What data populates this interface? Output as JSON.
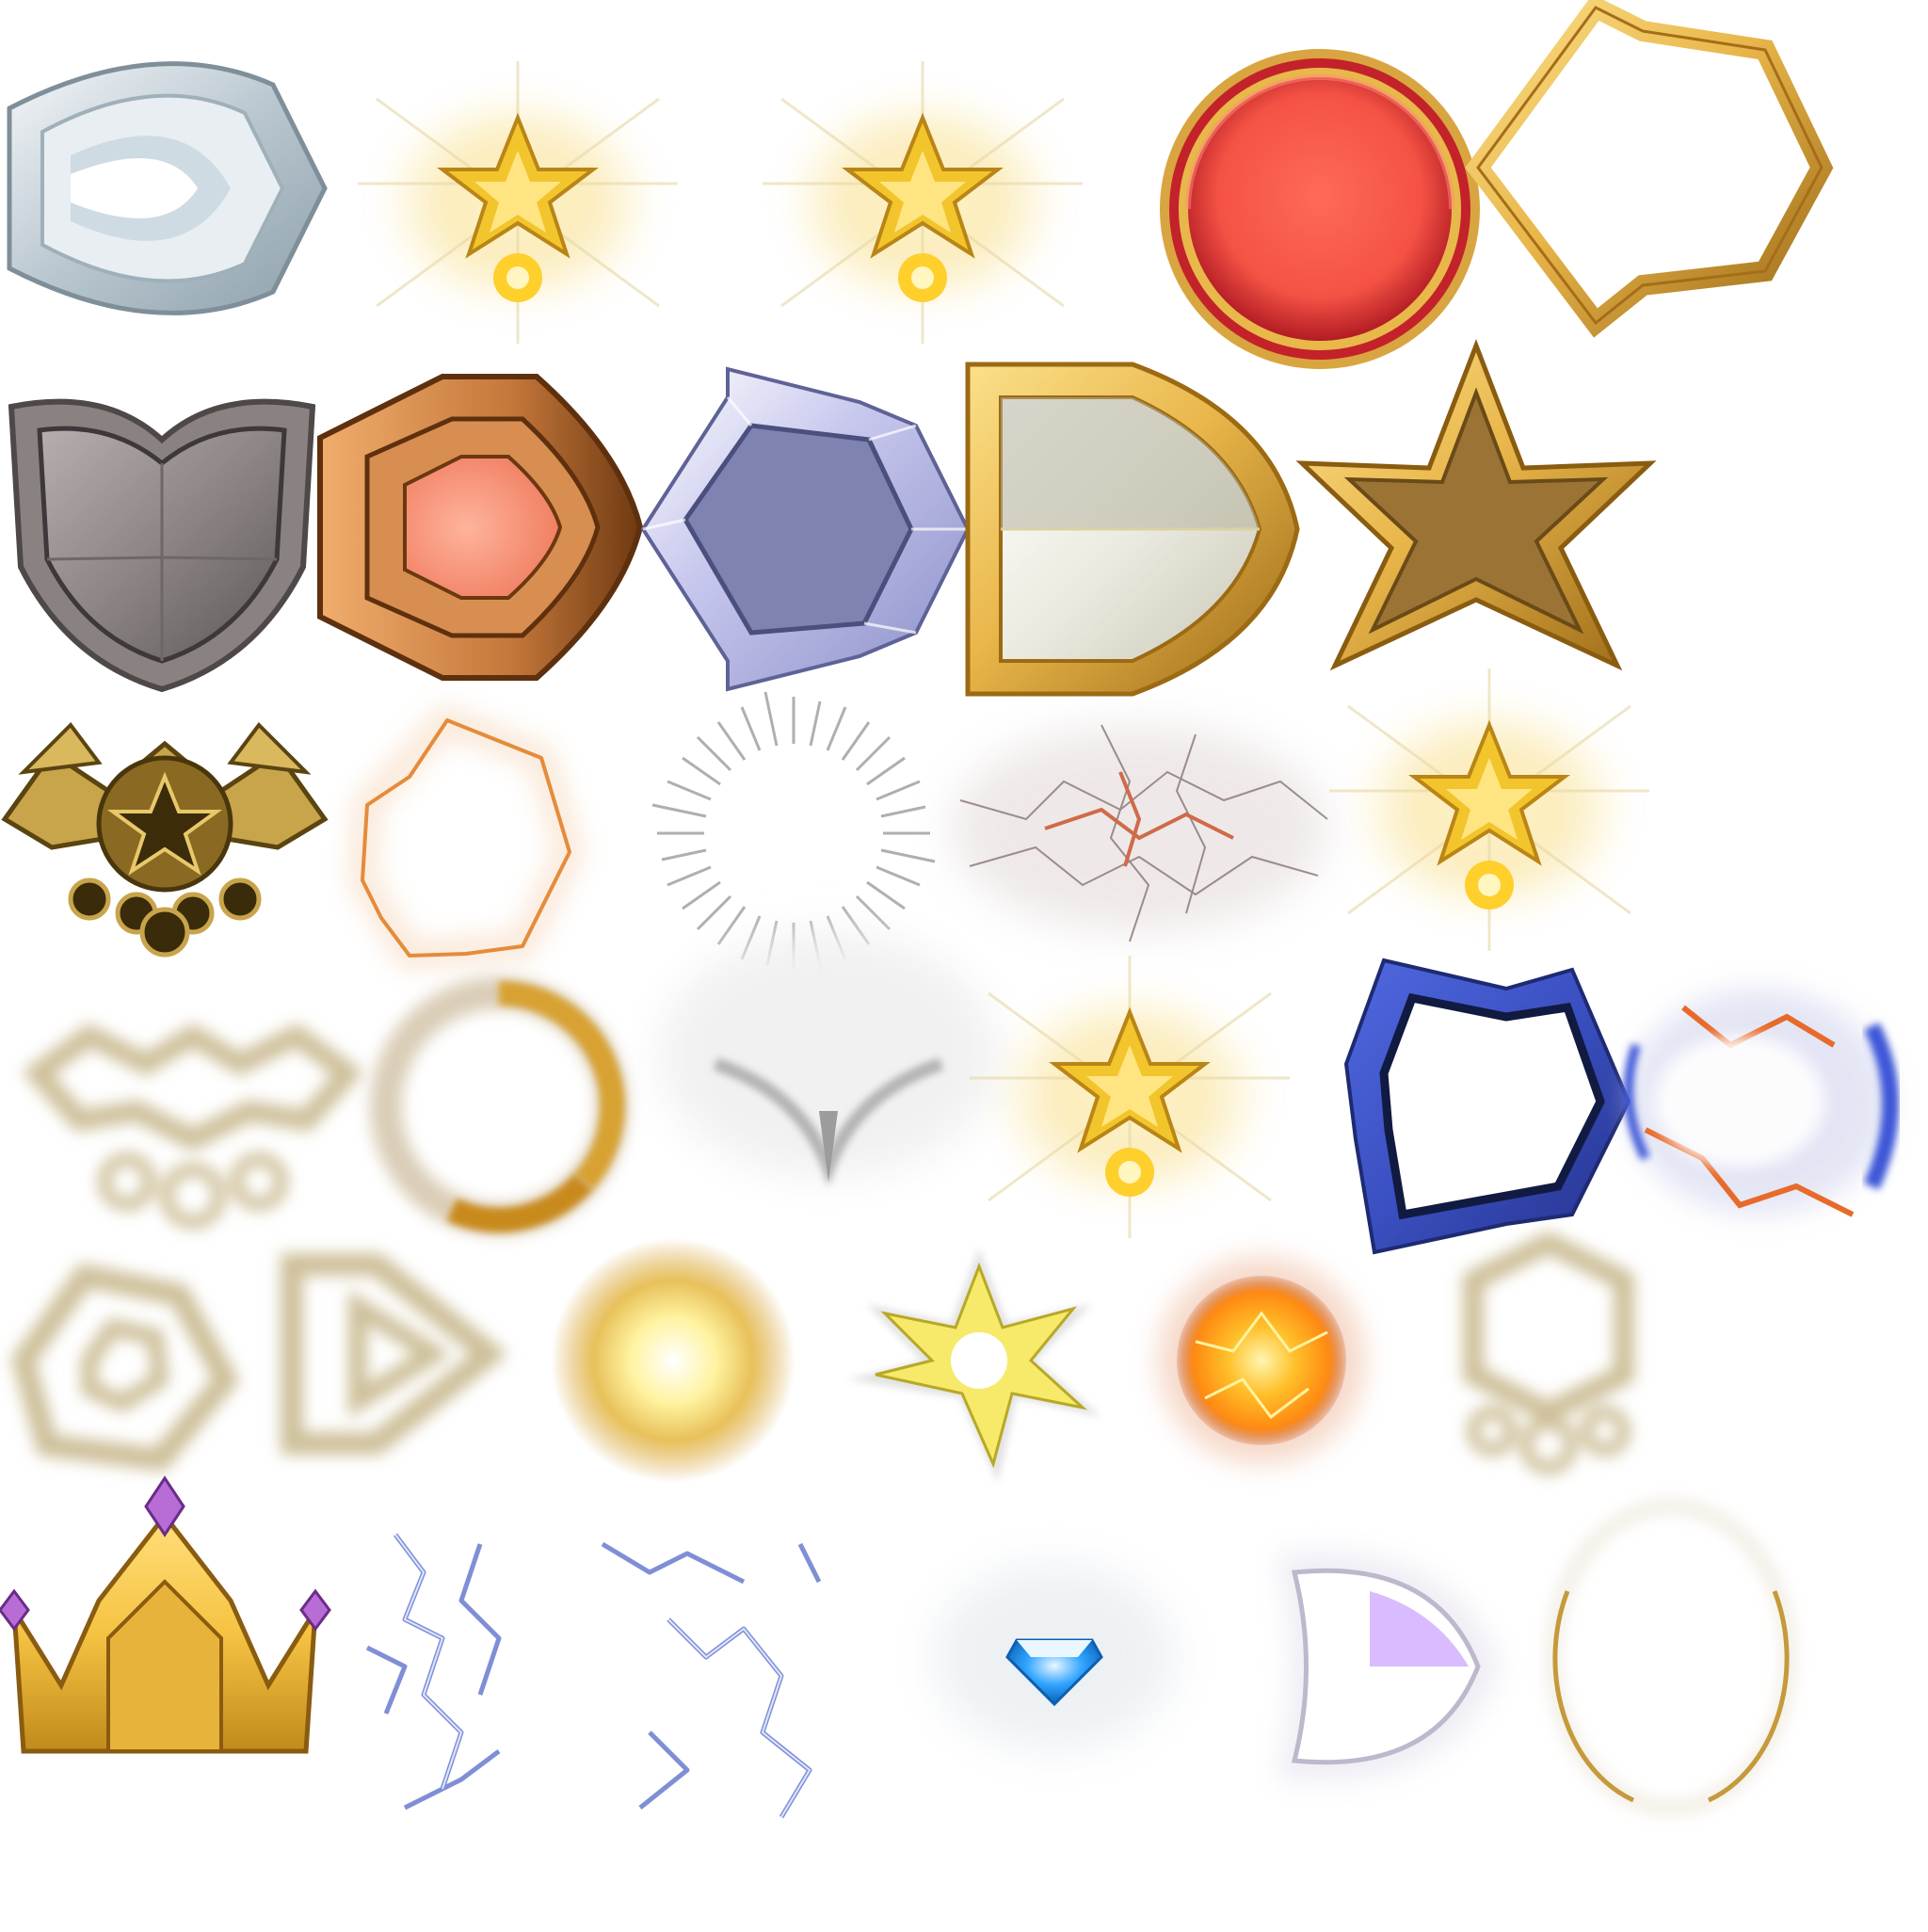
{
  "atlas": {
    "background": "#ffffff",
    "sprites": [
      {
        "id": "silver-shield-badge",
        "colors": [
          "#f4f7f9",
          "#b9c6cf",
          "#8da0ab"
        ]
      },
      {
        "id": "gold-star-glow-a",
        "colors": [
          "#f3c52c",
          "#fff6c0"
        ]
      },
      {
        "id": "gold-star-glow-b",
        "colors": [
          "#f3c52c",
          "#fff6c0"
        ]
      },
      {
        "id": "red-circle-badge",
        "colors": [
          "#ff6a57",
          "#c3222a",
          "#d9a540"
        ]
      },
      {
        "id": "gold-pentagon-frame",
        "colors": [
          "#e9b64a",
          "#a66d18"
        ]
      },
      {
        "id": "iron-heart-shield",
        "colors": [
          "#8d8585",
          "#5c5657",
          "#b7aeae"
        ]
      },
      {
        "id": "bronze-shield",
        "colors": [
          "#e2955a",
          "#9b5620",
          "#ff9a7f"
        ]
      },
      {
        "id": "lavender-pentagon-shield",
        "colors": [
          "#7f83b1",
          "#c8c8ee"
        ]
      },
      {
        "id": "gold-white-shield",
        "colors": [
          "#f1c64b",
          "#ecebe0",
          "#9a9a8c"
        ]
      },
      {
        "id": "gold-star-badge",
        "colors": [
          "#f2c356",
          "#9b7335"
        ]
      },
      {
        "id": "winged-star-emblem",
        "colors": [
          "#c8a44b",
          "#6b531c"
        ]
      },
      {
        "id": "orange-crackle-ring",
        "colors": [
          "#e58b3a"
        ]
      },
      {
        "id": "radial-burst-ring",
        "colors": [
          "#9c9c9c"
        ]
      },
      {
        "id": "red-lightning-cloud",
        "colors": [
          "#c46a5a",
          "#6e5c5c"
        ]
      },
      {
        "id": "gold-star-glow-c",
        "colors": [
          "#f3c52c"
        ]
      },
      {
        "id": "wing-glow-silhouette",
        "colors": [
          "#cdbf99"
        ]
      },
      {
        "id": "gold-glow-ring",
        "colors": [
          "#d8a233",
          "#bba57c"
        ]
      },
      {
        "id": "white-v-glow",
        "colors": [
          "#9c9c9c"
        ]
      },
      {
        "id": "gold-star-glow-d",
        "colors": [
          "#f3c52c"
        ]
      },
      {
        "id": "blue-pentagon-frame",
        "colors": [
          "#3a4fc0",
          "#1e2a72"
        ]
      },
      {
        "id": "blue-orange-explosion",
        "colors": [
          "#e86a2a",
          "#3d57d8"
        ]
      },
      {
        "id": "pentagon-glow-outline",
        "colors": [
          "#cdbf99"
        ]
      },
      {
        "id": "triangle-glow-outline",
        "colors": [
          "#cdbf99"
        ]
      },
      {
        "id": "gold-sun-orb",
        "colors": [
          "#fff3a0",
          "#d7a546"
        ]
      },
      {
        "id": "yellow-star-burst",
        "colors": [
          "#f7ea6b",
          "#cfcfcf"
        ]
      },
      {
        "id": "fire-orb",
        "colors": [
          "#ff9a12",
          "#ffd84a"
        ]
      },
      {
        "id": "hexagon-ring-glow",
        "colors": [
          "#cdbf99"
        ]
      },
      {
        "id": "gold-crown",
        "colors": [
          "#f5c343",
          "#b7861c",
          "#b86cd6"
        ]
      },
      {
        "id": "blue-electric-cracks-a",
        "colors": [
          "#7f8fd6"
        ]
      },
      {
        "id": "blue-electric-cracks-b",
        "colors": [
          "#7f8fd6"
        ]
      },
      {
        "id": "blue-diamond-gem",
        "colors": [
          "#2fa4ff",
          "#eaf7ff"
        ]
      },
      {
        "id": "purple-glow-shield",
        "colors": [
          "#c8a0ff",
          "#ffffff"
        ]
      },
      {
        "id": "gold-thin-ring",
        "colors": [
          "#c49a3a"
        ]
      }
    ]
  }
}
